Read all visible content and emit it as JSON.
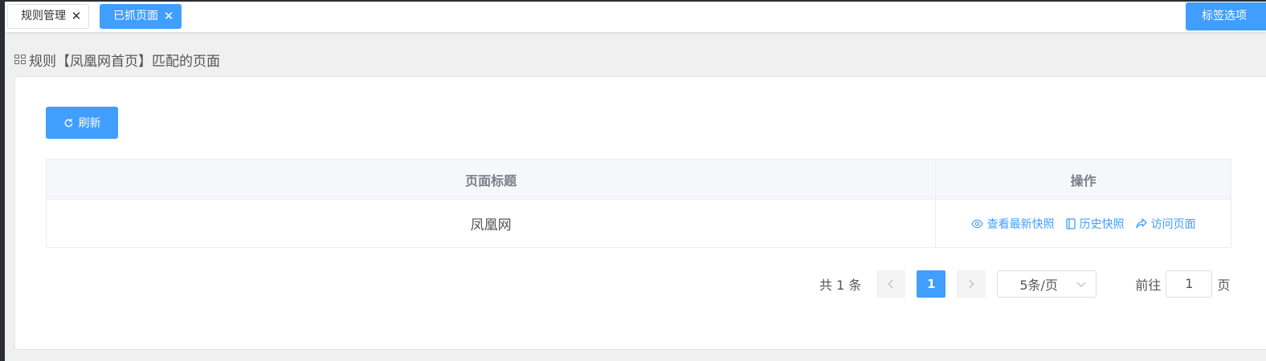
{
  "tabs": [
    {
      "label": "规则管理",
      "active": false
    },
    {
      "label": "已抓页面",
      "active": true
    }
  ],
  "tab_options_label": "标签选项",
  "page_title": "规则【凤凰网首页】匹配的页面",
  "refresh_label": "刷新",
  "table": {
    "columns": [
      "页面标题",
      "操作"
    ],
    "rows": [
      {
        "title": "凤凰网"
      }
    ],
    "actions": [
      "查看最新快照",
      "历史快照",
      "访问页面"
    ]
  },
  "pagination": {
    "total": "共 1 条",
    "current_page": "1",
    "page_size": "5条/页",
    "goto_label": "前往",
    "goto_value": "1",
    "page_suffix": "页"
  },
  "colors": {
    "accent": "#409eff",
    "header_bg": "#f5f7fa",
    "page_bg": "#f0f0f0"
  },
  "icons": [
    "close-icon",
    "grid-icon",
    "refresh-icon",
    "eye-icon",
    "book-icon",
    "share-icon",
    "chevron-left-icon",
    "chevron-right-icon",
    "chevron-down-icon"
  ]
}
